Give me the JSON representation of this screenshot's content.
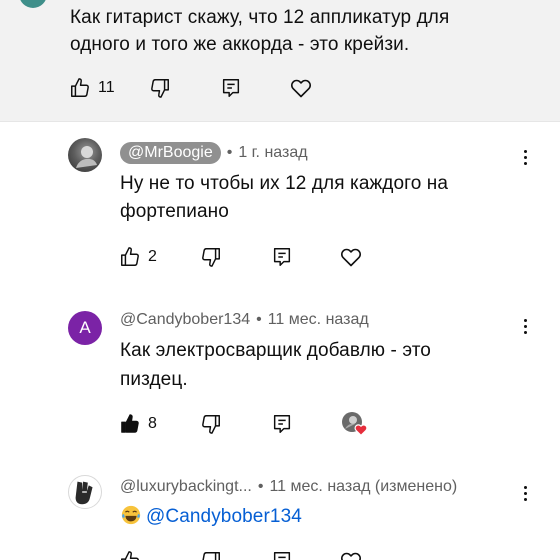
{
  "top_comment": {
    "text_line1": "Как гитарист скажу, что 12 аппликатур для",
    "text_line2": "одного и того же аккорда - это крейзи.",
    "likes": "11"
  },
  "replies": [
    {
      "author": "@MrBoogie",
      "time": "1 г. назад",
      "text_line1": "Ну не то чтобы их 12 для каждого на",
      "text_line2": "фортепиано",
      "likes": "2"
    },
    {
      "avatar_letter": "A",
      "author": "@Candybober134",
      "time": "11 мес. назад",
      "text_line1": "Как электросварщик добавлю - это",
      "text_line2": "пиздец.",
      "likes": "8"
    },
    {
      "author": "@luxurybackingt...",
      "time": "11 мес. назад (изменено)",
      "mention": "@Candybober134"
    }
  ],
  "separator": "•",
  "icons": {
    "like": "thumbs-up-icon",
    "dislike": "thumbs-down-icon",
    "reply": "reply-icon",
    "heart": "heart-icon",
    "more": "more-vert-icon",
    "emoji": "laughing-tears-emoji"
  },
  "colors": {
    "highlight_bg": "#f2f2f2",
    "mention": "#065fd4",
    "heart_red": "#e62d3c",
    "avatar_a": "#7b23a6"
  }
}
